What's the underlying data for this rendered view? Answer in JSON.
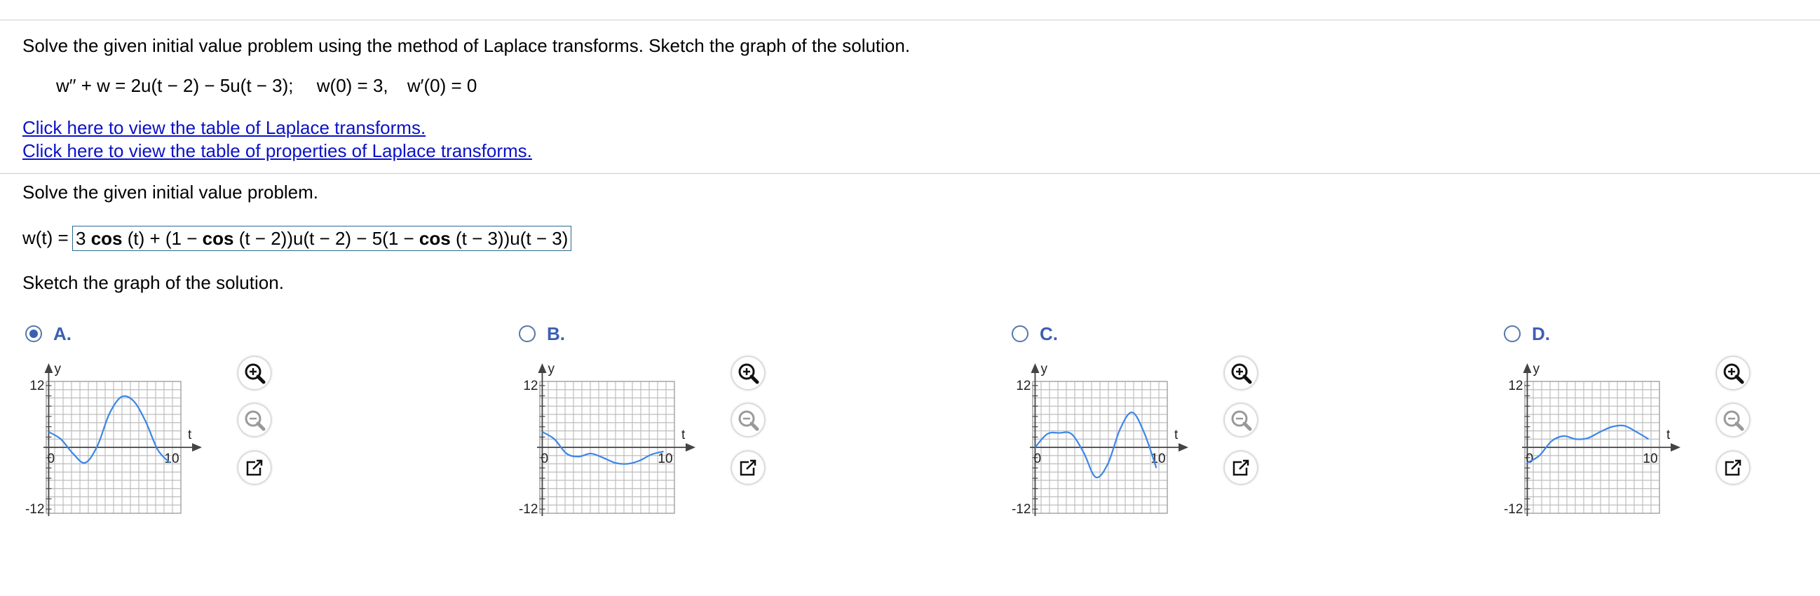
{
  "problem": {
    "instruction": "Solve the given initial value problem using the method of Laplace transforms. Sketch the graph of the solution.",
    "equation": "w′′ + w = 2u(t − 2) − 5u(t − 3);",
    "ic1": "w(0) = 3,",
    "ic2": "w′(0) = 0",
    "link1": "Click here to view the table of Laplace transforms.",
    "link2": "Click here to view the table of properties of Laplace transforms."
  },
  "part1": {
    "prompt": "Solve the given initial value problem.",
    "answer_prefix": "w(t) =",
    "answer": {
      "p1": "3 ",
      "cos1": "cos",
      "p2": " (t) + (1 −  ",
      "cos2": "cos",
      "p3": " (t − 2))u(t − 2) − 5(1 −  ",
      "cos3": "cos",
      "p4": " (t − 3))u(t − 3)"
    }
  },
  "part2": {
    "prompt": "Sketch the graph of the solution.",
    "selected": "A",
    "options": [
      {
        "letter": "A.",
        "curve": "option-a"
      },
      {
        "letter": "B.",
        "curve": "option-b"
      },
      {
        "letter": "C.",
        "curve": "option-c"
      },
      {
        "letter": "D.",
        "curve": "option-d"
      }
    ],
    "graph_labels": {
      "y_axis": "y",
      "x_axis": "t",
      "y_max": "12",
      "y_min": "-12",
      "x_zero": "0",
      "x_max": "10"
    }
  },
  "chart_data": [
    {
      "type": "line",
      "series": [
        {
          "points": [
            [
              0,
              3
            ],
            [
              1,
              1.6
            ],
            [
              2,
              -1.2
            ],
            [
              3,
              -3.0
            ],
            [
              4,
              0.2
            ],
            [
              5,
              6.5
            ],
            [
              6,
              9.8
            ],
            [
              7,
              9.0
            ],
            [
              8,
              5.0
            ],
            [
              9,
              -0.5
            ],
            [
              10,
              -3.0
            ]
          ]
        }
      ],
      "xlim": [
        0,
        10
      ],
      "ylim": [
        -12,
        12
      ]
    },
    {
      "type": "line",
      "series": [
        {
          "points": [
            [
              0,
              3
            ],
            [
              1,
              1.6
            ],
            [
              2,
              -1.2
            ],
            [
              3,
              -1.8
            ],
            [
              4,
              -1.2
            ],
            [
              5,
              -2.0
            ],
            [
              6,
              -3.0
            ],
            [
              7,
              -3.2
            ],
            [
              8,
              -2.6
            ],
            [
              9,
              -1.4
            ],
            [
              10,
              -0.8
            ]
          ]
        }
      ],
      "xlim": [
        0,
        10
      ],
      "ylim": [
        -12,
        12
      ]
    },
    {
      "type": "line",
      "series": [
        {
          "points": [
            [
              0,
              0
            ],
            [
              1,
              2.6
            ],
            [
              2,
              2.8
            ],
            [
              3,
              2.6
            ],
            [
              4,
              -1.0
            ],
            [
              5,
              -5.8
            ],
            [
              6,
              -3.2
            ],
            [
              7,
              3.5
            ],
            [
              8,
              6.8
            ],
            [
              9,
              2.8
            ],
            [
              10,
              -4.0
            ]
          ]
        }
      ],
      "xlim": [
        0,
        10
      ],
      "ylim": [
        -12,
        12
      ]
    },
    {
      "type": "line",
      "series": [
        {
          "points": [
            [
              0,
              -3
            ],
            [
              1,
              -1.6
            ],
            [
              2,
              1.2
            ],
            [
              3,
              2.2
            ],
            [
              4,
              1.6
            ],
            [
              5,
              1.8
            ],
            [
              6,
              3.0
            ],
            [
              7,
              4.0
            ],
            [
              8,
              4.2
            ],
            [
              9,
              3.0
            ],
            [
              10,
              1.6
            ]
          ]
        }
      ],
      "xlim": [
        0,
        10
      ],
      "ylim": [
        -12,
        12
      ]
    }
  ],
  "colors": {
    "curve": "#3a86e8",
    "link": "#0b12c8",
    "radio": "#3b5fb5"
  }
}
